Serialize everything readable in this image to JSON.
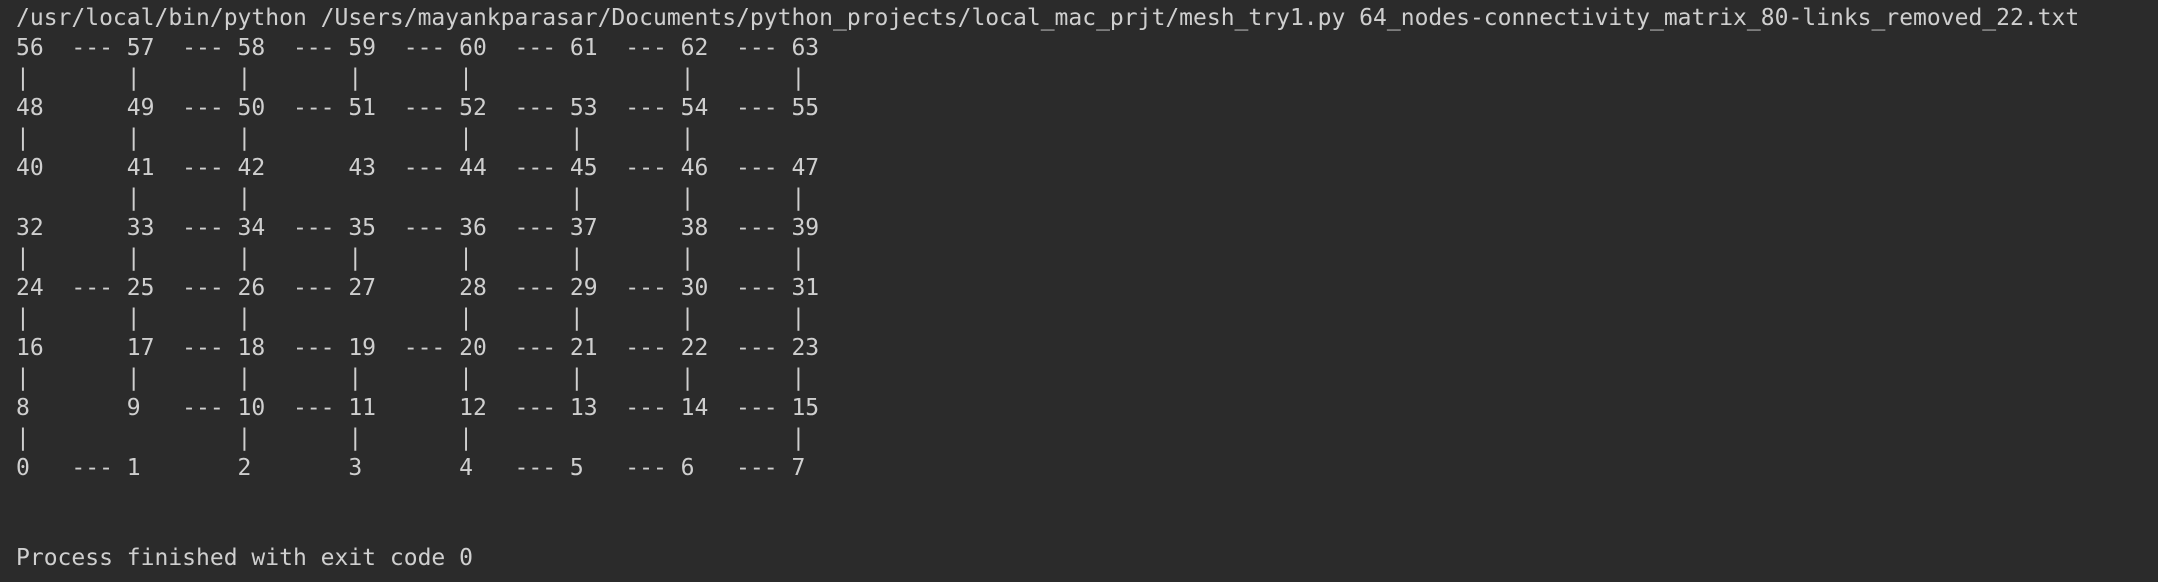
{
  "console": {
    "command": "/usr/local/bin/python /Users/mayankparasar/Documents/python_projects/local_mac_prjt/mesh_try1.py 64_nodes-connectivity_matrix_80-links_removed_22.txt",
    "lines": [
      "56  --- 57  --- 58  --- 59  --- 60  --- 61  --- 62  --- 63",
      "|       |       |       |       |               |       |",
      "48      49  --- 50  --- 51  --- 52  --- 53  --- 54  --- 55",
      "|       |       |               |       |       |",
      "40      41  --- 42      43  --- 44  --- 45  --- 46  --- 47",
      "        |       |                       |       |       |",
      "32      33  --- 34  --- 35  --- 36  --- 37      38  --- 39",
      "|       |       |       |       |       |       |       |",
      "24  --- 25  --- 26  --- 27      28  --- 29  --- 30  --- 31",
      "|       |       |               |       |       |       |",
      "16      17  --- 18  --- 19  --- 20  --- 21  --- 22  --- 23",
      "|       |       |       |       |       |       |       |",
      "8       9   --- 10  --- 11      12  --- 13  --- 14  --- 15",
      "|               |       |       |                       |",
      "0   --- 1       2       3       4   --- 5   --- 6   --- 7"
    ],
    "exit_message": "Process finished with exit code 0"
  }
}
